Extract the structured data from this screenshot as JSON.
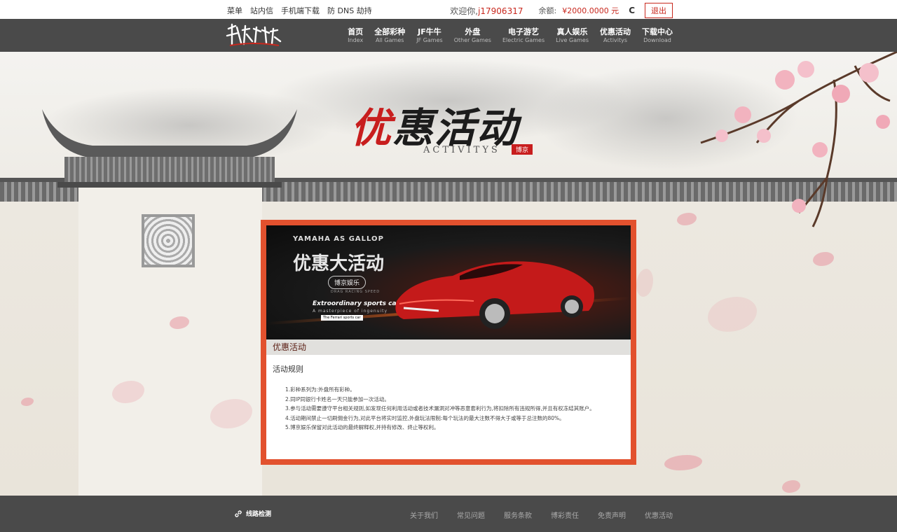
{
  "topbar": {
    "links": [
      "菜单",
      "站内信",
      "手机端下载",
      "防 DNS 劫持"
    ],
    "welcome_prefix": "欢迎你,",
    "username": "j17906317",
    "balance_label": "余额:",
    "balance_value": "¥2000.0000 元",
    "refresh_glyph": "C",
    "logout_label": "退出"
  },
  "nav": {
    "items": [
      {
        "cn": "首页",
        "en": "Index"
      },
      {
        "cn": "全部彩种",
        "en": "All Games"
      },
      {
        "cn": "JF牛牛",
        "en": "JF Games"
      },
      {
        "cn": "外盘",
        "en": "Other Games"
      },
      {
        "cn": "电子游艺",
        "en": "Electric Games"
      },
      {
        "cn": "真人娱乐",
        "en": "Live Games"
      },
      {
        "cn": "优惠活动",
        "en": "Activitys"
      },
      {
        "cn": "下载中心",
        "en": "Download"
      }
    ]
  },
  "hero": {
    "title_first": "优",
    "title_rest": "惠活动",
    "subtitle": "ACTIVITYS",
    "seal": "博京"
  },
  "promo": {
    "yamaha": "YAMAHA AS GALLOP",
    "headline": "优惠大活动",
    "brand": "博京娱乐",
    "brand_sub": "DRAG RACING SPEED",
    "tagline": "Extroordinary sports car",
    "subtag": "A masterpiece of ingenuity",
    "badge": "The Ferrari sports car"
  },
  "section": {
    "title": "优惠活动",
    "rules_title": "活动规则",
    "rules": [
      "1.彩种系列为:外盘所有彩种。",
      "2.同IP同银行卡姓名一天只能参加一次活动。",
      "3.参与活动需要遵守平台相关规则,如发现任何利用活动或者技术漏洞对冲等恶意套利行为,将扣除所有违规所得,并且有权冻结其账户。",
      "4.活动期间禁止一切刷佣金行为,对此平台将实时监控,外盘玩法限制:每个玩法的最大注数不得大于或等于总注数的80%。",
      "5.博京娱乐保留对此活动的最终解释权,并持有修改、终止等权利。"
    ]
  },
  "footer": {
    "line_check": "线路检测",
    "links": [
      "关于我们",
      "常见问题",
      "服务条款",
      "博彩责任",
      "免责声明",
      "优惠活动"
    ]
  },
  "colors": {
    "accent": "#c8281e",
    "panel_border": "#e2512e",
    "nav_bg": "#4a4a4a"
  }
}
